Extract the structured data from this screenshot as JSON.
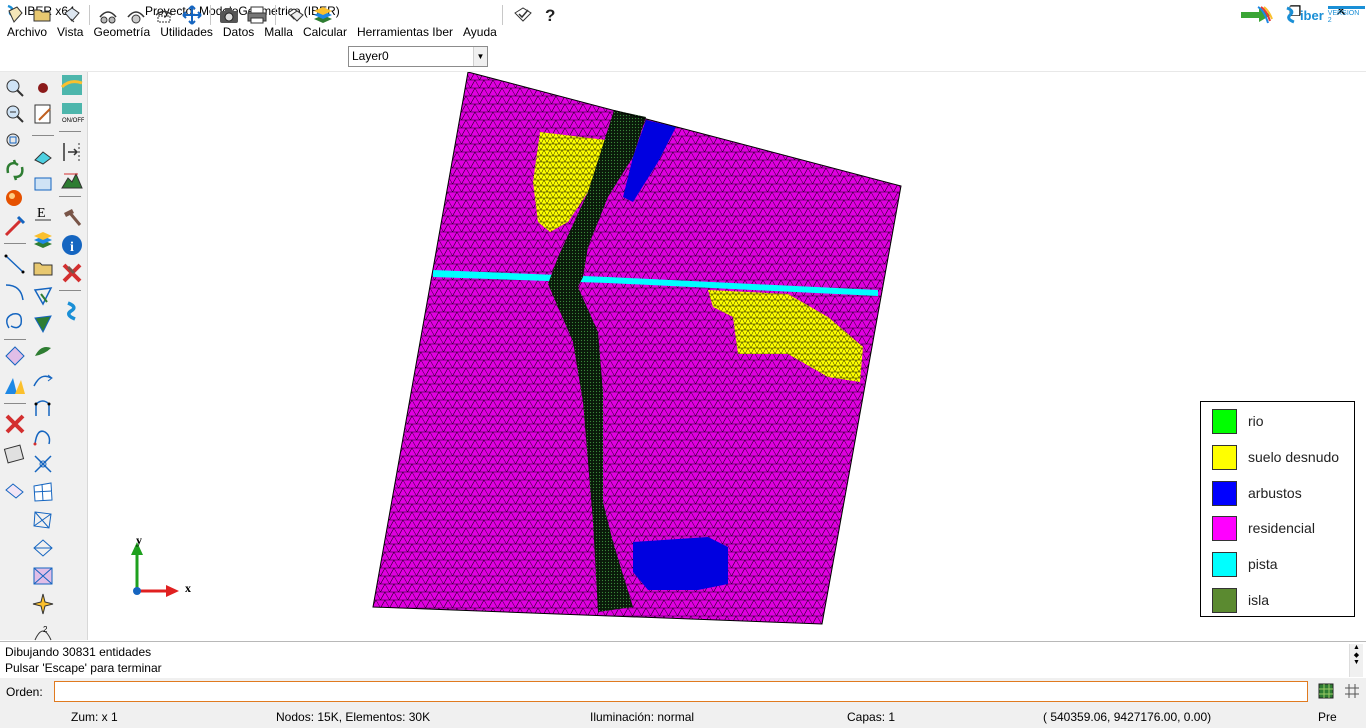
{
  "window": {
    "app_title": "IBER x64",
    "project_title": "Proyecto: ModeloGeometrico (IBER)",
    "minimize": "—",
    "maximize": "❐",
    "close": "✕"
  },
  "menu": [
    "Archivo",
    "Vista",
    "Geometría",
    "Utilidades",
    "Datos",
    "Malla",
    "Calcular",
    "Herramientas Iber",
    "Ayuda"
  ],
  "toolbar": {
    "layer_value": "Layer0",
    "brand_text": "iber",
    "brand_version": "VERSION 2",
    "icons": [
      "new-file-icon",
      "open-folder-icon",
      "save-icon",
      "rotate-icon",
      "rotate-trackball-icon",
      "zoom-frame-icon",
      "pan-icon",
      "camera-icon",
      "print-icon",
      "layers-copy-icon",
      "layers-icon",
      "help-check-icon",
      "help-icon"
    ]
  },
  "axes": {
    "x": "x",
    "y": "y"
  },
  "legend": {
    "items": [
      {
        "label": "rio",
        "color": "#00ff00"
      },
      {
        "label": "suelo desnudo",
        "color": "#ffff00"
      },
      {
        "label": "arbustos",
        "color": "#0000ff"
      },
      {
        "label": "residencial",
        "color": "#ff00ff"
      },
      {
        "label": "pista",
        "color": "#00ffff"
      },
      {
        "label": "isla",
        "color": "#5b8a30"
      }
    ]
  },
  "messages": {
    "line1": "Dibujando 30831 entidades",
    "line2": "Pulsar 'Escape' para terminar"
  },
  "command": {
    "label": "Orden:",
    "value": ""
  },
  "status": {
    "zoom": "Zum: x 1",
    "nodes": "Nodos: 15K, Elementos: 30K",
    "lighting": "Iluminación: normal",
    "layers": "Capas: 1",
    "coords": "( 540359.06,  9427176.00,  0.00)",
    "mode": "Pre"
  }
}
